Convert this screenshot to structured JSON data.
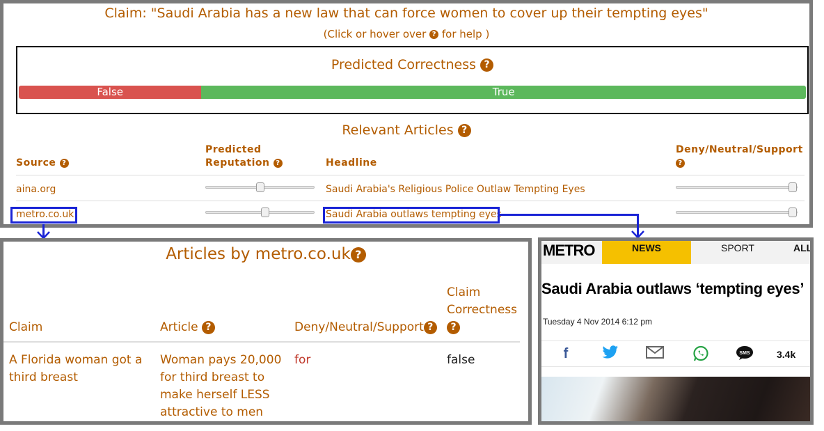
{
  "claim": {
    "title": "Claim: \"Saudi Arabia has a new law that can force women to cover up their tempting eyes\"",
    "help_prefix": "(Click or hover over",
    "help_suffix": "for help )"
  },
  "prediction": {
    "title": "Predicted Correctness",
    "false_label": "False",
    "true_label": "True",
    "false_fraction": 0.232,
    "true_fraction": 0.768
  },
  "relevant_articles": {
    "title": "Relevant Articles",
    "columns": {
      "source": "Source",
      "reputation": "Predicted Reputation",
      "headline": "Headline",
      "stance": "Deny/Neutral/Support"
    },
    "rows": [
      {
        "source": "aina.org",
        "reputation": 0.5,
        "headline": "Saudi Arabia's Religious Police Outlaw Tempting Eyes",
        "stance": 1.0
      },
      {
        "source": "metro.co.uk",
        "reputation": 0.55,
        "headline": "Saudi Arabia outlaws tempting eyes",
        "stance": 1.0
      }
    ]
  },
  "articles_by_source": {
    "title": "Articles by metro.co.uk",
    "columns": {
      "claim": "Claim",
      "article": "Article",
      "stance": "Deny/Neutral/Support",
      "correctness": "Claim Correctness"
    },
    "rows": [
      {
        "claim": "A Florida woman got a third breast",
        "article": "Woman pays 20,000 for third breast to make herself LESS attractive to men",
        "stance": "for",
        "correctness": "false"
      }
    ]
  },
  "metro_page": {
    "logo": "METRO",
    "nav": [
      "NEWS",
      "SPORT",
      "ALL"
    ],
    "headline": "Saudi Arabia outlaws ‘tempting eyes’",
    "date": "Tuesday 4 Nov 2014 6:12 pm",
    "share_icons": [
      "facebook-icon",
      "twitter-icon",
      "email-icon",
      "whatsapp-icon",
      "sms-icon"
    ],
    "share_count": "3.4k"
  },
  "colors": {
    "accent": "#b35c00",
    "false_bar": "#d9534f",
    "true_bar": "#5cb85c",
    "highlight": "#1a24d6",
    "panel_border": "#7a7a7a",
    "stance_for": "#c0392b",
    "metro_yellow": "#f5c000"
  }
}
